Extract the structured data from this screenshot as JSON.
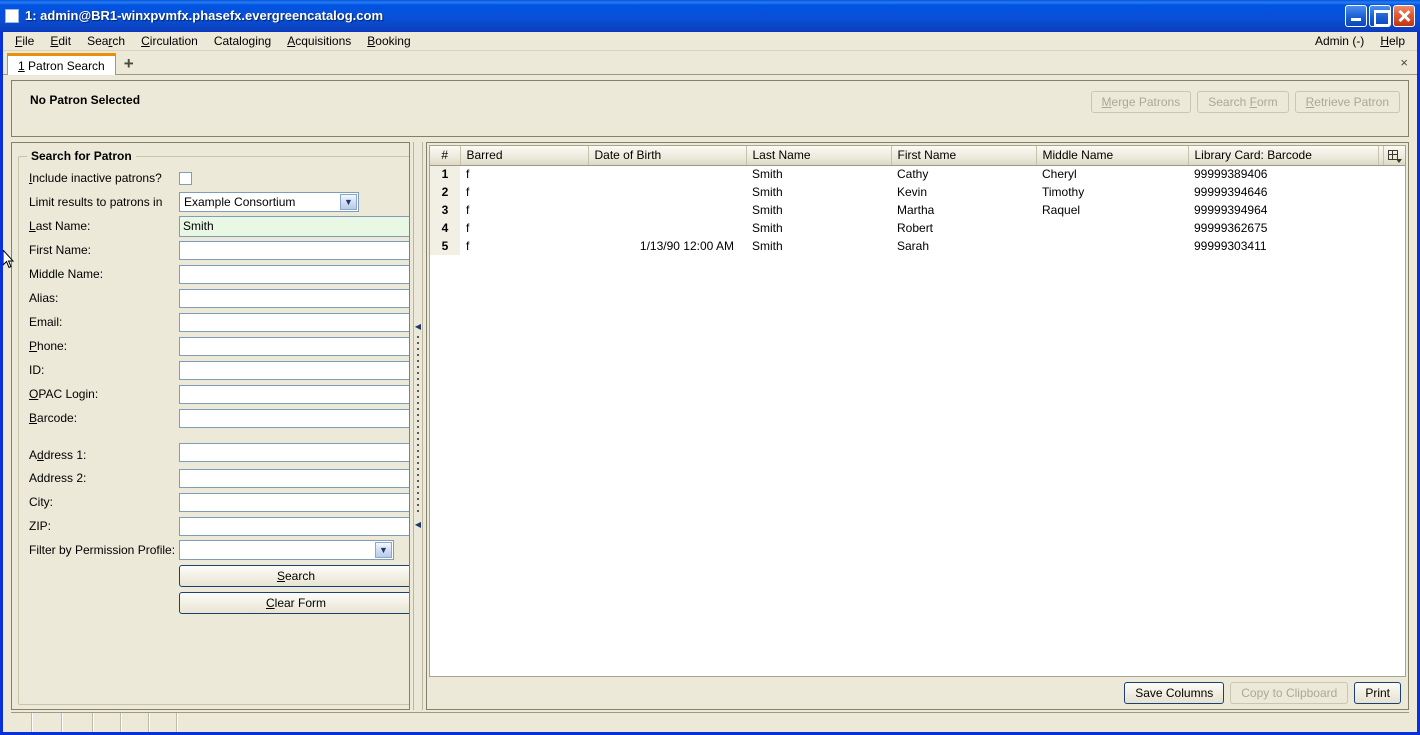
{
  "window": {
    "title": "1: admin@BR1-winxpvmfx.phasefx.evergreencatalog.com",
    "minimize_label": "Minimize",
    "maximize_label": "Maximize",
    "close_label": "Close"
  },
  "menu": {
    "items": [
      {
        "label": "File",
        "accel": "F"
      },
      {
        "label": "Edit",
        "accel": "E"
      },
      {
        "label": "Search",
        "accel": "r"
      },
      {
        "label": "Circulation",
        "accel": "C"
      },
      {
        "label": "Cataloging",
        "accel": "g"
      },
      {
        "label": "Acquisitions",
        "accel": "A"
      },
      {
        "label": "Booking",
        "accel": "B"
      }
    ],
    "right_items": [
      {
        "label": "Admin (-)"
      },
      {
        "label": "Help",
        "accel": "H"
      }
    ]
  },
  "tabs": {
    "items": [
      {
        "label": "1 Patron Search",
        "active": true
      }
    ],
    "add_label": "+",
    "close_all_label": "×"
  },
  "patron_header": {
    "status": "No Patron Selected",
    "buttons": [
      {
        "label": "Merge Patrons",
        "enabled": false
      },
      {
        "label": "Search Form",
        "enabled": false
      },
      {
        "label": "Retrieve Patron",
        "enabled": false
      }
    ]
  },
  "search_form": {
    "legend": "Search for Patron",
    "include_inactive_label": "Include inactive patrons?",
    "include_inactive_checked": false,
    "limit_results_label": "Limit results to patrons in",
    "limit_results_value": "Example Consortium",
    "fields": [
      {
        "label": "Last Name:",
        "value": "Smith",
        "focused": true
      },
      {
        "label": "First Name:",
        "value": "",
        "focused": false
      },
      {
        "label": "Middle Name:",
        "value": "",
        "focused": false
      },
      {
        "label": "Alias:",
        "value": "",
        "focused": false
      },
      {
        "label": "Email:",
        "value": "",
        "focused": false
      },
      {
        "label": "Phone:",
        "value": "",
        "focused": false
      },
      {
        "label": "ID:",
        "value": "",
        "focused": false
      },
      {
        "label": "OPAC Login:",
        "value": "",
        "focused": false
      },
      {
        "label": "Barcode:",
        "value": "",
        "focused": false
      }
    ],
    "address_fields": [
      {
        "label": "Address 1:",
        "value": ""
      },
      {
        "label": "Address 2:",
        "value": ""
      },
      {
        "label": "City:",
        "value": ""
      },
      {
        "label": "ZIP:",
        "value": ""
      }
    ],
    "permission_profile_label": "Filter by Permission Profile:",
    "permission_profile_value": "",
    "search_button": "Search",
    "clear_button": "Clear Form"
  },
  "results": {
    "columns": [
      {
        "key": "num",
        "label": "#"
      },
      {
        "key": "barred",
        "label": "Barred"
      },
      {
        "key": "dob",
        "label": "Date of Birth"
      },
      {
        "key": "last",
        "label": "Last Name"
      },
      {
        "key": "first",
        "label": "First Name"
      },
      {
        "key": "middle",
        "label": "Middle Name"
      },
      {
        "key": "barcode",
        "label": "Library Card: Barcode"
      }
    ],
    "column_picker_label": "Column Picker",
    "rows": [
      {
        "num": "1",
        "barred": "f",
        "dob": "",
        "last": "Smith",
        "first": "Cathy",
        "middle": "Cheryl",
        "barcode": "99999389406"
      },
      {
        "num": "2",
        "barred": "f",
        "dob": "",
        "last": "Smith",
        "first": "Kevin",
        "middle": "Timothy",
        "barcode": "99999394646"
      },
      {
        "num": "3",
        "barred": "f",
        "dob": "",
        "last": "Smith",
        "first": "Martha",
        "middle": "Raquel",
        "barcode": "99999394964"
      },
      {
        "num": "4",
        "barred": "f",
        "dob": "",
        "last": "Smith",
        "first": "Robert",
        "middle": "",
        "barcode": "99999362675"
      },
      {
        "num": "5",
        "barred": "f",
        "dob": "1/13/90 12:00 AM",
        "last": "Smith",
        "first": "Sarah",
        "middle": "",
        "barcode": "99999303411"
      }
    ],
    "footer_buttons": [
      {
        "label": "Save Columns",
        "enabled": true
      },
      {
        "label": "Copy to Clipboard",
        "enabled": false
      },
      {
        "label": "Print",
        "enabled": true
      }
    ]
  },
  "colors": {
    "title_bar": "#0054e3",
    "window_frame": "#0831d9",
    "face": "#ece9d8",
    "tab_accent": "#e8900c",
    "focused_field": "#e8f8e4",
    "field_border": "#7f9db9"
  }
}
